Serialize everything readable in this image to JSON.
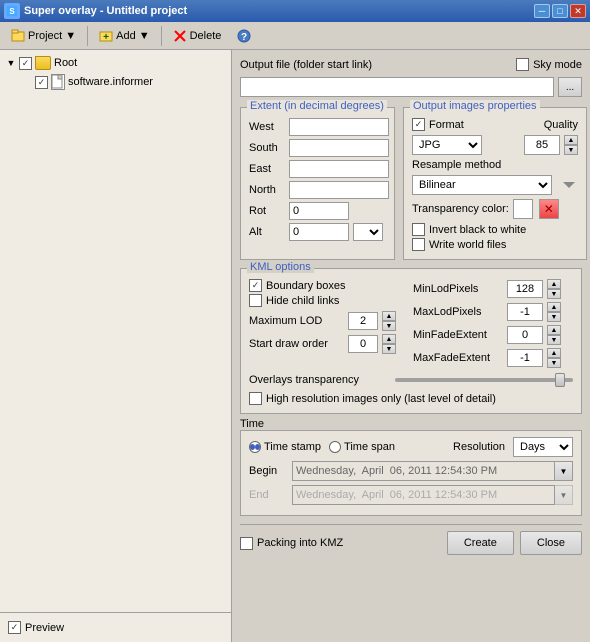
{
  "window": {
    "title": "Super overlay - Untitled project"
  },
  "toolbar": {
    "project_label": "Project",
    "add_label": "Add",
    "delete_label": "Delete"
  },
  "tree": {
    "root_label": "Root",
    "child_label": "software.informer"
  },
  "preview": {
    "label": "Preview"
  },
  "output_file": {
    "label": "Output file (folder start link)",
    "value": "",
    "placeholder": ""
  },
  "sky_mode": {
    "label": "Sky mode"
  },
  "browse_btn": {
    "label": "..."
  },
  "extent": {
    "title": "Extent (in decimal degrees)",
    "west_label": "West",
    "south_label": "South",
    "east_label": "East",
    "north_label": "North",
    "rot_label": "Rot",
    "rot_value": "0",
    "alt_label": "Alt",
    "alt_value": "0"
  },
  "output_props": {
    "title": "Output images properties",
    "format_label": "Format",
    "format_checked": true,
    "format_value": "JPG",
    "quality_label": "Quality",
    "quality_value": "85",
    "resample_label": "Resample method",
    "resample_value": "Bilinear",
    "transparency_label": "Transparency color:",
    "invert_label": "Invert black to white",
    "write_world_label": "Write world files"
  },
  "kml_options": {
    "title": "KML options",
    "boundary_boxes_label": "Boundary boxes",
    "boundary_boxes_checked": true,
    "hide_child_label": "Hide child links",
    "hide_child_checked": false,
    "max_lod_label": "Maximum LOD",
    "max_lod_value": "2",
    "start_draw_label": "Start draw order",
    "start_draw_value": "0",
    "min_lod_pixels_label": "MinLodPixels",
    "min_lod_pixels_value": "128",
    "max_lod_pixels_label": "MaxLodPixels",
    "max_lod_pixels_value": "-1",
    "min_fade_label": "MinFadeExtent",
    "min_fade_value": "0",
    "max_fade_label": "MaxFadeExtent",
    "max_fade_value": "-1",
    "overlays_transparency_label": "Overlays transparency",
    "high_res_label": "High resolution images only (last level of detail)"
  },
  "time": {
    "title": "Time",
    "timestamp_label": "Time stamp",
    "timespan_label": "Time span",
    "resolution_label": "Resolution",
    "resolution_value": "Days",
    "begin_label": "Begin",
    "begin_value": "Wednesday,  April  06, 2011 12:54:30 PM",
    "end_label": "End",
    "end_value": "Wednesday,  April  06, 2011 12:54:30 PM"
  },
  "bottom": {
    "packing_label": "Packing into KMZ",
    "create_label": "Create",
    "close_label": "Close"
  },
  "icons": {
    "check": "✓",
    "arrow_down": "▼",
    "arrow_up": "▲",
    "close_x": "✕",
    "minimize": "─",
    "maximize": "□",
    "close": "✕"
  }
}
